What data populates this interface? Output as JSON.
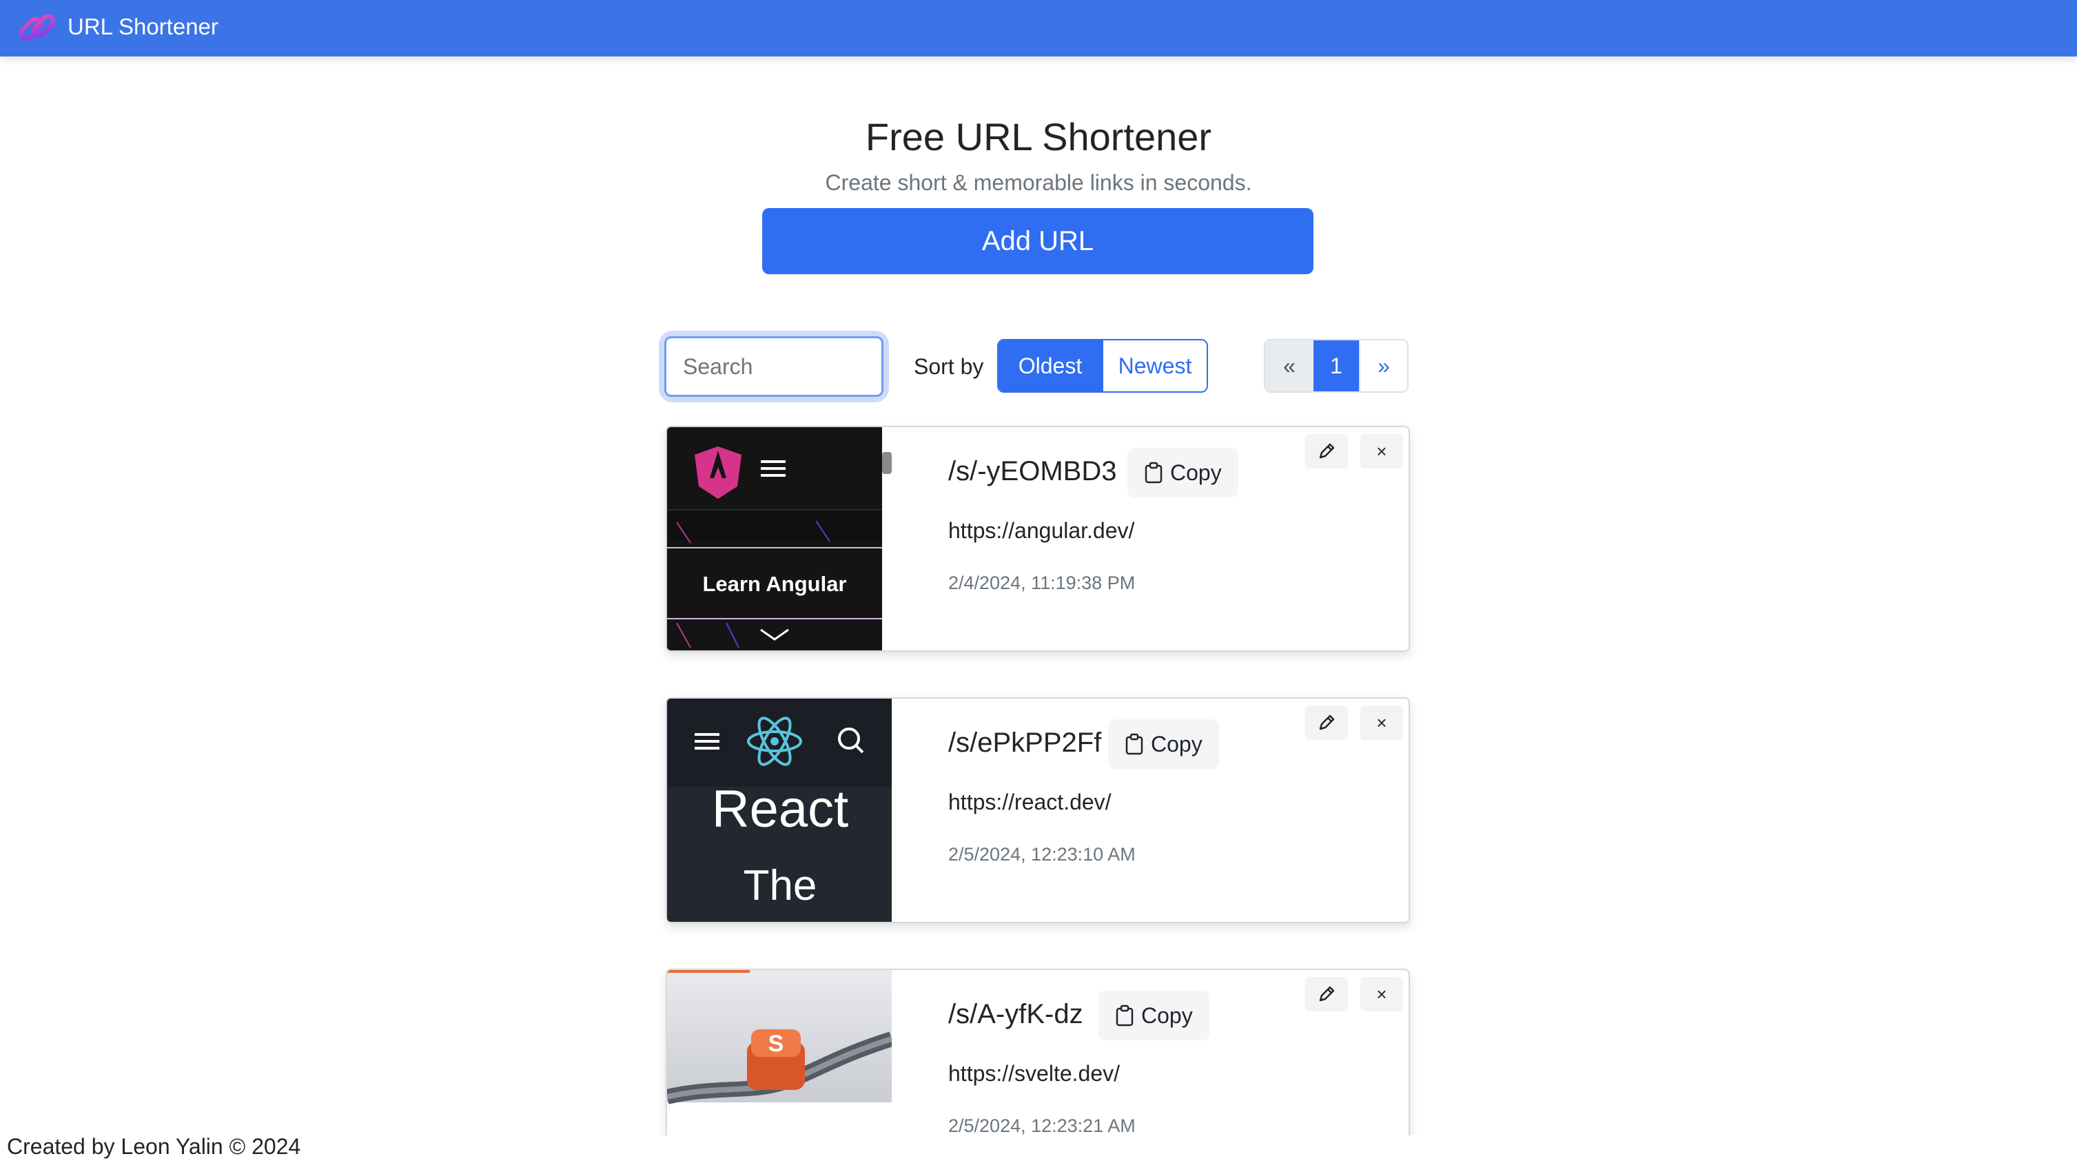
{
  "navbar": {
    "brand": "URL Shortener",
    "logo_icon": "chain-link-icon"
  },
  "hero": {
    "title": "Free URL Shortener",
    "subtitle": "Create short & memorable links in seconds.",
    "add_button": "Add URL"
  },
  "controls": {
    "search_placeholder": "Search",
    "sort_label": "Sort by",
    "sort_options": [
      "Oldest",
      "Newest"
    ],
    "sort_selected": "Oldest",
    "pagination": {
      "prev": "«",
      "current": "1",
      "next": "»"
    }
  },
  "links": [
    {
      "short": "/s/-yEOMBD3",
      "copy_label": "Copy",
      "url": "https://angular.dev/",
      "created": "2/4/2024, 11:19:38 PM",
      "thumb_text": "Learn Angular"
    },
    {
      "short": "/s/ePkPP2Ff",
      "copy_label": "Copy",
      "url": "https://react.dev/",
      "created": "2/5/2024, 12:23:10 AM",
      "thumb_text_1": "React",
      "thumb_text_2": "The"
    },
    {
      "short": "/s/A-yfK-dz",
      "copy_label": "Copy",
      "url": "https://svelte.dev/",
      "created": "2/5/2024, 12:23:21 AM"
    }
  ],
  "card_icons": {
    "edit": "pencil-icon",
    "delete": "close-icon",
    "copy": "clipboard-icon"
  },
  "delete_glyph": "×",
  "footer": "Created by Leon Yalin © 2024",
  "colors": {
    "primary": "#3b74e6",
    "button": "#2f6ef2",
    "muted": "#6c757d"
  }
}
